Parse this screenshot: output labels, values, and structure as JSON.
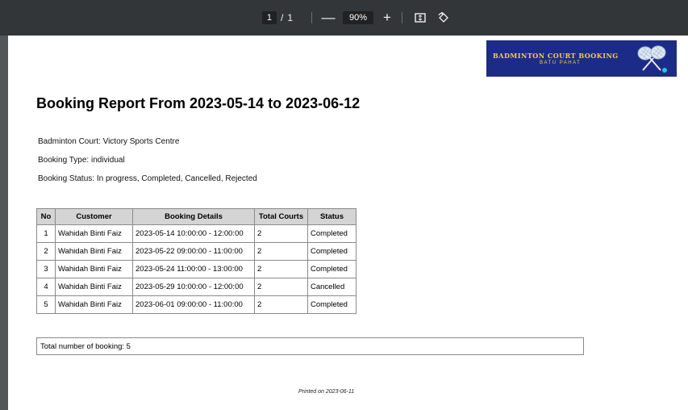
{
  "toolbar": {
    "current_page": "1",
    "page_separator": "/",
    "total_pages": "1",
    "zoom_out_label": "—",
    "zoom_value": "90%",
    "zoom_in_label": "+",
    "fit_icon": "fit-page-icon",
    "rotate_icon": "rotate-icon"
  },
  "logo": {
    "title": "BADMINTON COURT BOOKING",
    "subtitle": "BATU PAHAT",
    "icon": "crossed-rackets-icon"
  },
  "report": {
    "title": "Booking Report From 2023-05-14 to 2023-06-12",
    "court": "Badminton Court: Victory Sports Centre",
    "type": "Booking Type: individual",
    "status": "Booking Status: In progress, Completed, Cancelled, Rejected",
    "columns": [
      "No",
      "Customer",
      "Booking Details",
      "Total Courts",
      "Status"
    ],
    "rows": [
      {
        "no": "1",
        "customer": "Wahidah Binti Faiz",
        "details": "2023-05-14 10:00:00 - 12:00:00",
        "courts": "2",
        "status": "Completed"
      },
      {
        "no": "2",
        "customer": "Wahidah Binti Faiz",
        "details": "2023-05-22 09:00:00 - 11:00:00",
        "courts": "2",
        "status": "Completed"
      },
      {
        "no": "3",
        "customer": "Wahidah Binti Faiz",
        "details": "2023-05-24 11:00:00 - 13:00:00",
        "courts": "2",
        "status": "Completed"
      },
      {
        "no": "4",
        "customer": "Wahidah Binti Faiz",
        "details": "2023-05-29 10:00:00 - 12:00:00",
        "courts": "2",
        "status": "Cancelled"
      },
      {
        "no": "5",
        "customer": "Wahidah Binti Faiz",
        "details": "2023-06-01 09:00:00 - 11:00:00",
        "courts": "2",
        "status": "Completed"
      }
    ],
    "total_label": "Total number of booking:  5",
    "printed": "Printed on 2023-06-11"
  },
  "colors": {
    "toolbar_bg": "#323639",
    "viewer_bg": "#525659",
    "logo_bg": "#1d2b88",
    "logo_text": "#f1d14a",
    "header_bg": "#d4d4d4"
  }
}
